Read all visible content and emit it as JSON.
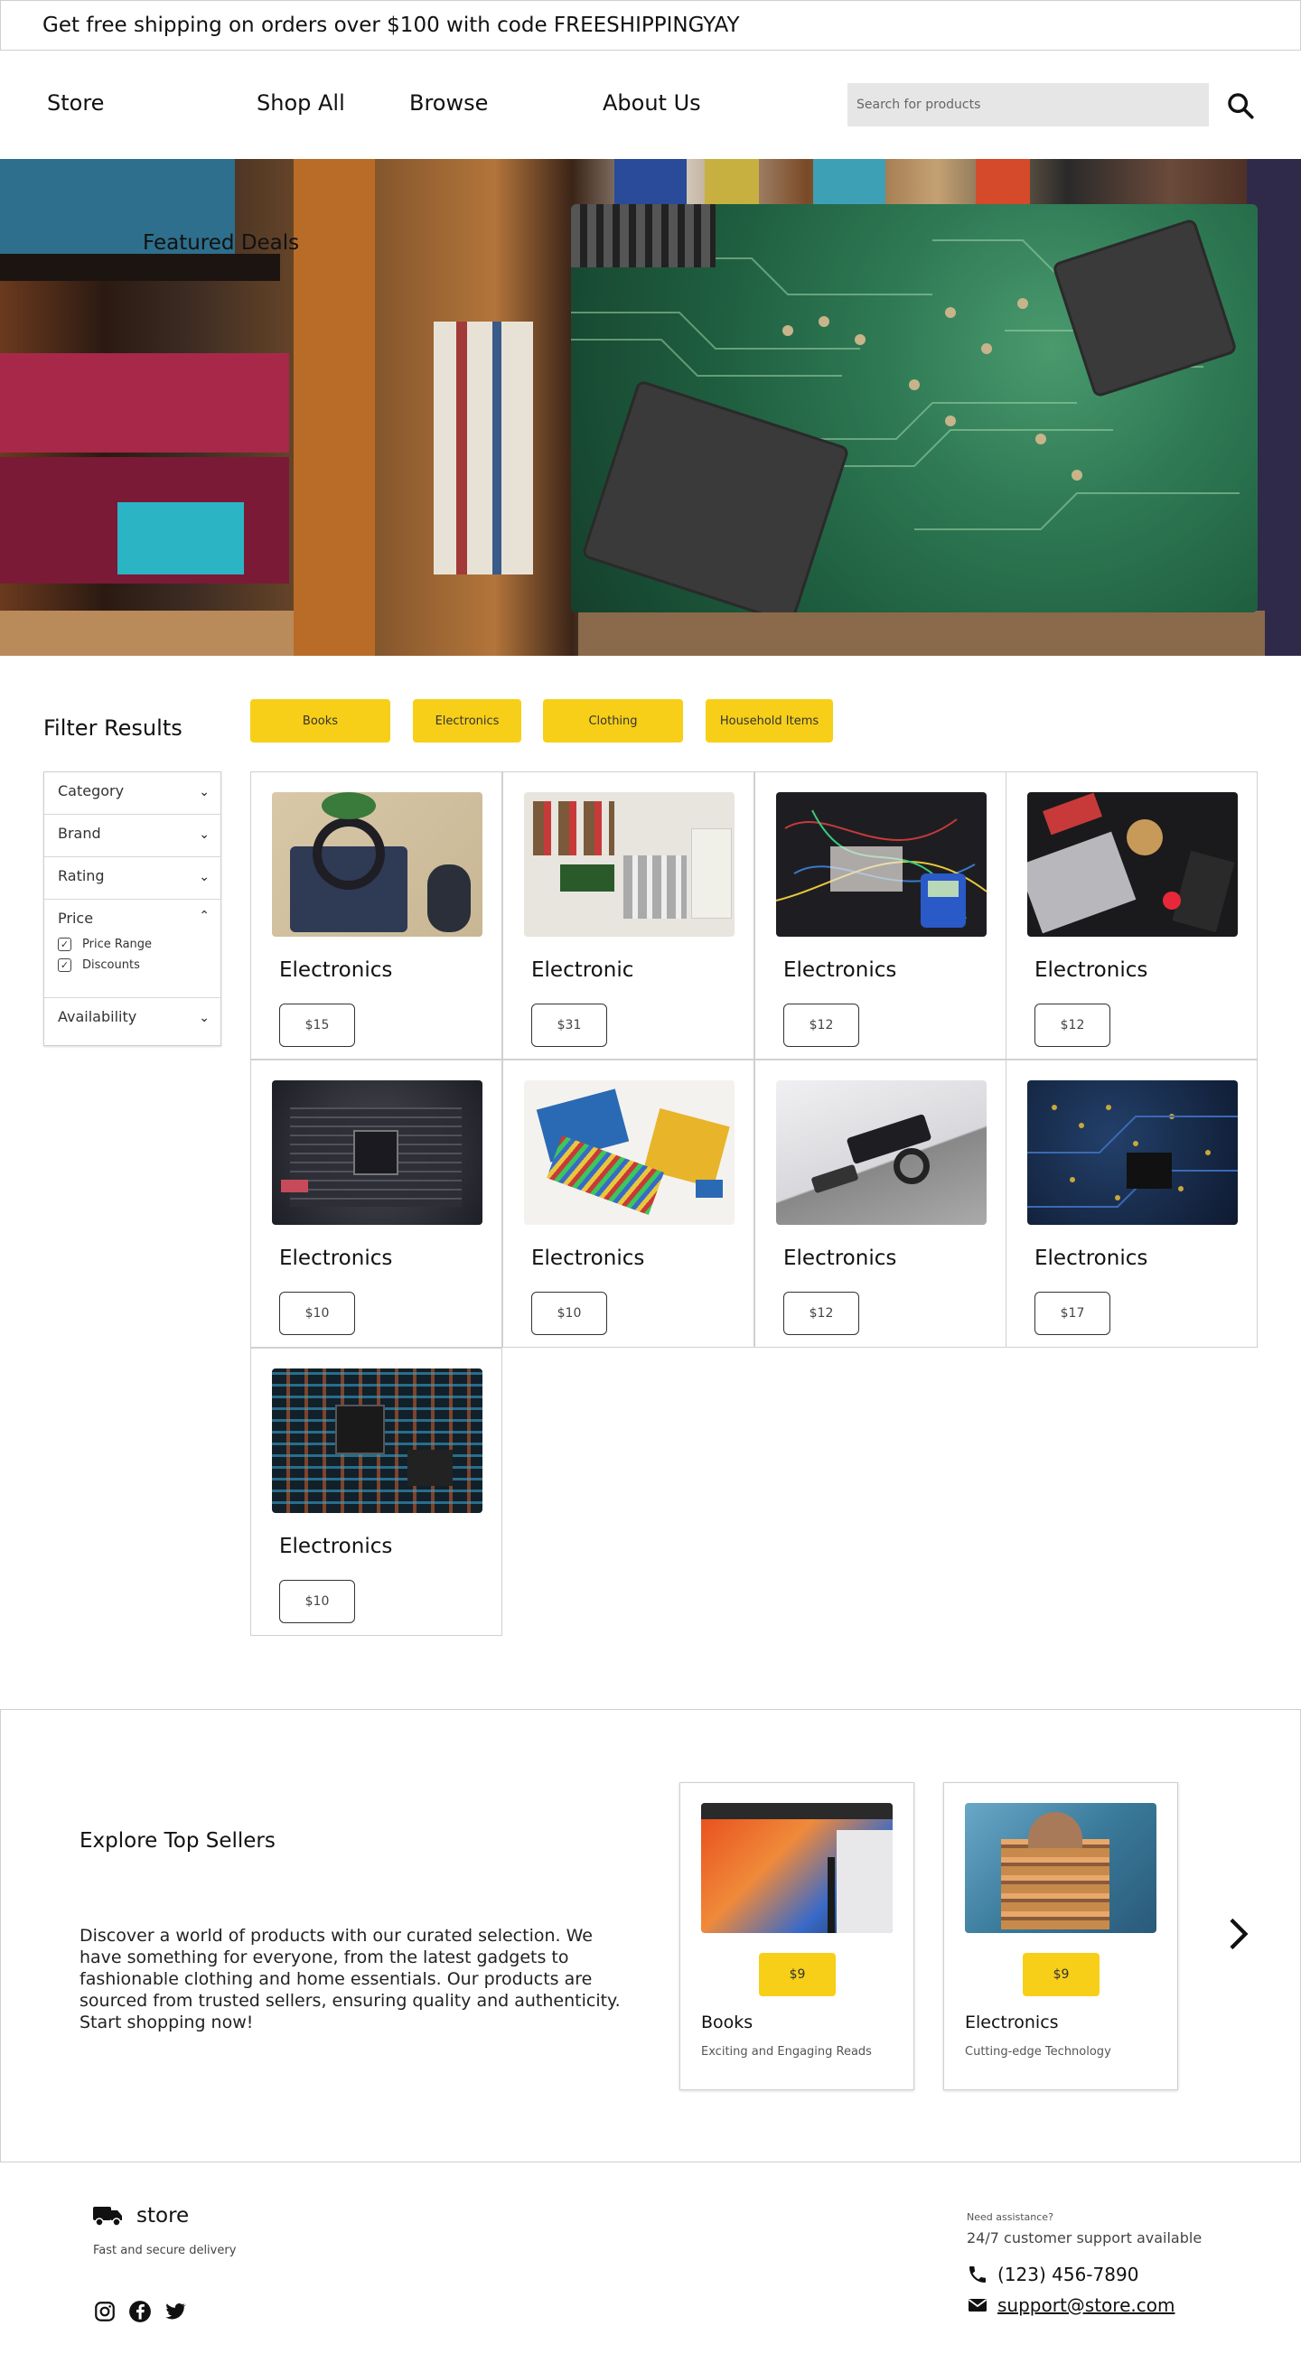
{
  "announcement": "Get free shipping on orders over $100 with code FREESHIPPINGYAY",
  "nav": {
    "logo": "Store",
    "links": [
      "Shop All",
      "Browse",
      "About Us"
    ],
    "search_placeholder": "Search for products"
  },
  "hero": {
    "title": "Featured Deals"
  },
  "filter": {
    "title": "Filter Results",
    "sections": [
      "Category",
      "Brand",
      "Rating",
      "Price",
      "Availability"
    ],
    "price_options": [
      "Price Range",
      "Discounts"
    ]
  },
  "categories": [
    "Books",
    "Electronics",
    "Clothing",
    "Household Items"
  ],
  "products": [
    {
      "name": "Electronics",
      "price": "$15"
    },
    {
      "name": "Electronic",
      "price": "$31"
    },
    {
      "name": "Electronics",
      "price": "$12"
    },
    {
      "name": "Electronics",
      "price": "$12"
    },
    {
      "name": "Electronics",
      "price": "$10"
    },
    {
      "name": "Electronics",
      "price": "$10"
    },
    {
      "name": "Electronics",
      "price": "$12"
    },
    {
      "name": "Electronics",
      "price": "$17"
    },
    {
      "name": "Electronics",
      "price": "$10"
    }
  ],
  "top_sellers": {
    "title": "Explore Top Sellers",
    "description": "Discover a world of products with our curated selection. We have something for everyone, from the latest gadgets to fashionable clothing and home essentials. Our products are sourced from trusted sellers, ensuring quality and authenticity. Start shopping now!",
    "items": [
      {
        "price": "$9",
        "name": "Books",
        "subtitle": "Exciting and Engaging Reads"
      },
      {
        "price": "$9",
        "name": "Electronics",
        "subtitle": "Cutting-edge Technology"
      }
    ]
  },
  "footer": {
    "brand": "store",
    "tagline": "Fast and secure delivery",
    "help_label": "Need assistance?",
    "help_text": "24/7 customer support available",
    "phone": "(123) 456-7890",
    "email": "support@store.com"
  },
  "colors": {
    "accent": "#f7cf18"
  },
  "icons": [
    "search-icon",
    "chevron-down-icon",
    "chevron-up-icon",
    "check-icon",
    "chevron-right-icon",
    "truck-icon",
    "instagram-icon",
    "facebook-icon",
    "twitter-icon",
    "phone-icon",
    "mail-icon"
  ]
}
